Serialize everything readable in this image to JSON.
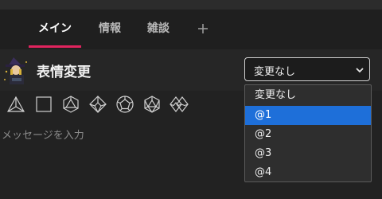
{
  "tabs": [
    {
      "label": "メイン",
      "active": true
    },
    {
      "label": "情報",
      "active": false
    },
    {
      "label": "雑談",
      "active": false
    }
  ],
  "add_tab_icon": "plus-icon",
  "header": {
    "avatar_icon": "witch-avatar",
    "title": "表情変更"
  },
  "expression_select": {
    "value": "変更なし",
    "options": [
      "変更なし",
      "@1",
      "@2",
      "@3",
      "@4"
    ],
    "highlighted": "@1"
  },
  "dice_icons": [
    "d4-icon",
    "d6-icon",
    "d8-icon",
    "d10-icon",
    "d12-icon",
    "d20-icon",
    "d100-icon"
  ],
  "chat": {
    "placeholder": "メッセージを入力",
    "value": ""
  },
  "colors": {
    "accent": "#e0245e",
    "highlight": "#1e6fd9",
    "background": "#232323"
  }
}
